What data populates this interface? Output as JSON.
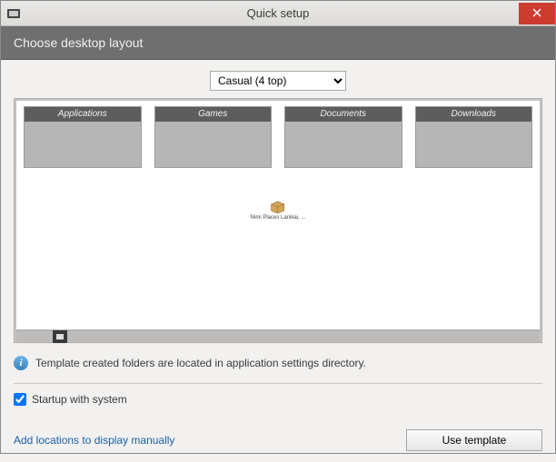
{
  "window": {
    "title": "Quick setup"
  },
  "header": {
    "text": "Choose desktop layout"
  },
  "layout_select": {
    "selected": "Casual (4 top)"
  },
  "folders": [
    {
      "label": "Applications"
    },
    {
      "label": "Games"
    },
    {
      "label": "Documents"
    },
    {
      "label": "Downloads"
    }
  ],
  "preview_center": {
    "label": "Nimi Places Lanikai, ..."
  },
  "info": {
    "text": "Template created folders are located in application settings directory."
  },
  "startup_checkbox": {
    "label": "Startup with system",
    "checked": true
  },
  "footer": {
    "link_text": "Add locations to display manually",
    "button_text": "Use template"
  }
}
